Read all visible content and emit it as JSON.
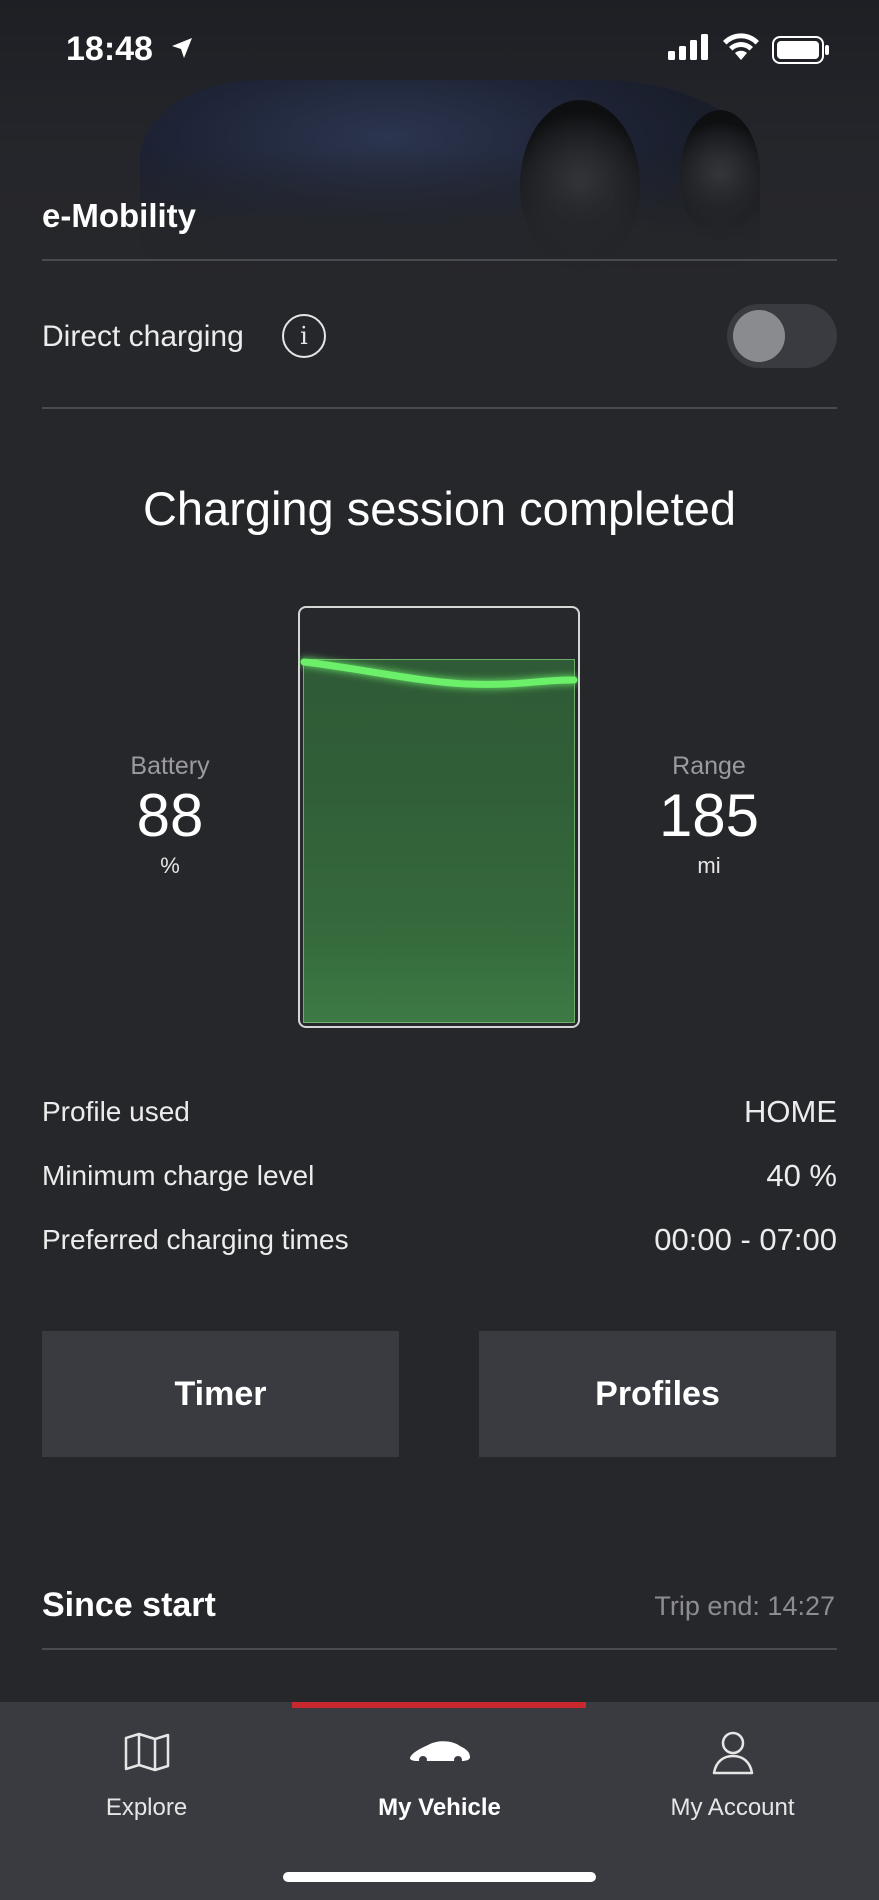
{
  "status_bar": {
    "time": "18:48",
    "icons": [
      "location-arrow-icon",
      "signal-icon",
      "wifi-icon",
      "battery-icon"
    ]
  },
  "header": {
    "title": "e-Mobility"
  },
  "direct_charging": {
    "label": "Direct charging",
    "info_icon": "i",
    "enabled": false
  },
  "charging": {
    "headline": "Charging session completed",
    "battery_label": "Battery",
    "battery_value": "88",
    "battery_unit": "%",
    "range_label": "Range",
    "range_value": "185",
    "range_unit": "mi",
    "fill_level": 0.88,
    "fill_color": "#3d7a45",
    "glow_color": "#6cf06a"
  },
  "details": [
    {
      "label": "Profile used",
      "value": "HOME"
    },
    {
      "label": "Minimum charge level",
      "value": "40 %"
    },
    {
      "label": "Preferred charging times",
      "value": "00:00 - 07:00"
    }
  ],
  "buttons": {
    "timer": "Timer",
    "profiles": "Profiles"
  },
  "since_start": {
    "title": "Since start",
    "trip_end": "Trip end: 14:27"
  },
  "tabbar": {
    "accent": "#c8282e",
    "tabs": [
      {
        "label": "Explore",
        "icon": "map-icon"
      },
      {
        "label": "My Vehicle",
        "icon": "car-icon",
        "active": true
      },
      {
        "label": "My Account",
        "icon": "person-icon"
      }
    ]
  }
}
